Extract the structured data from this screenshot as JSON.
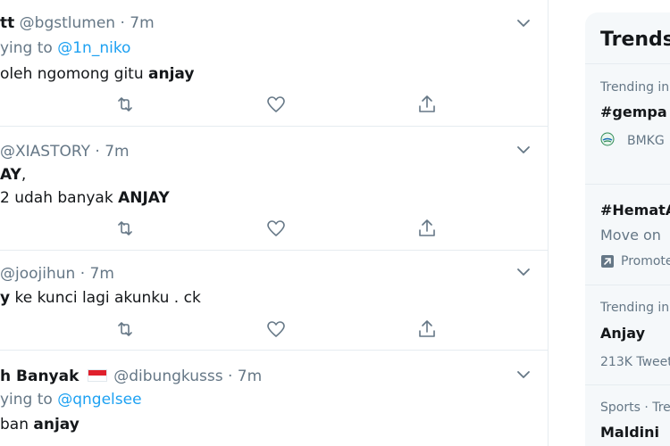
{
  "tweets": [
    {
      "name": "tt",
      "handle": "@bgstlumen",
      "dot": "·",
      "time": "7m",
      "reply_prefix": "ying to",
      "reply_to": "@1n_niko",
      "text_plain": "oleh ngomong gitu ",
      "text_bold": "anjay"
    },
    {
      "handle": "@XIASTORY",
      "dot": "·",
      "time": "7m",
      "line1_bold": "AY",
      "line1_plain": ",",
      "text_plain": "2 udah banyak ",
      "text_bold": "ANJAY"
    },
    {
      "handle": "@joojihun",
      "dot": "·",
      "time": "7m",
      "text_bold": "y",
      "text_plain": " ke kunci lagi akunku  . ck"
    },
    {
      "name": "h Banyak",
      "handle": "@dibungkusss",
      "dot": "·",
      "time": "7m",
      "reply_prefix": "ying to",
      "reply_to": "@qngelsee",
      "text_plain": "ban ",
      "text_bold": "anjay"
    }
  ],
  "sidebar": {
    "title": "Trends",
    "trend1": {
      "context": "Trending in",
      "topic": "#gempa",
      "source": "BMKG"
    },
    "trend2": {
      "topic": "#HematA",
      "subtitle": "Move on",
      "promoted": "Promote"
    },
    "trend3": {
      "context": "Trending in",
      "topic": "Anjay",
      "count": "213K Tweet"
    },
    "trend4": {
      "context": "Sports · Tre",
      "topic": "Maldini"
    }
  },
  "icons": {
    "reply": "reply-icon",
    "retweet": "retweet-icon",
    "like": "heart-icon",
    "share": "share-icon",
    "caret": "chevron-down-icon"
  },
  "colors": {
    "link": "#1da1f2",
    "muted": "#657786",
    "text": "#14171a"
  }
}
